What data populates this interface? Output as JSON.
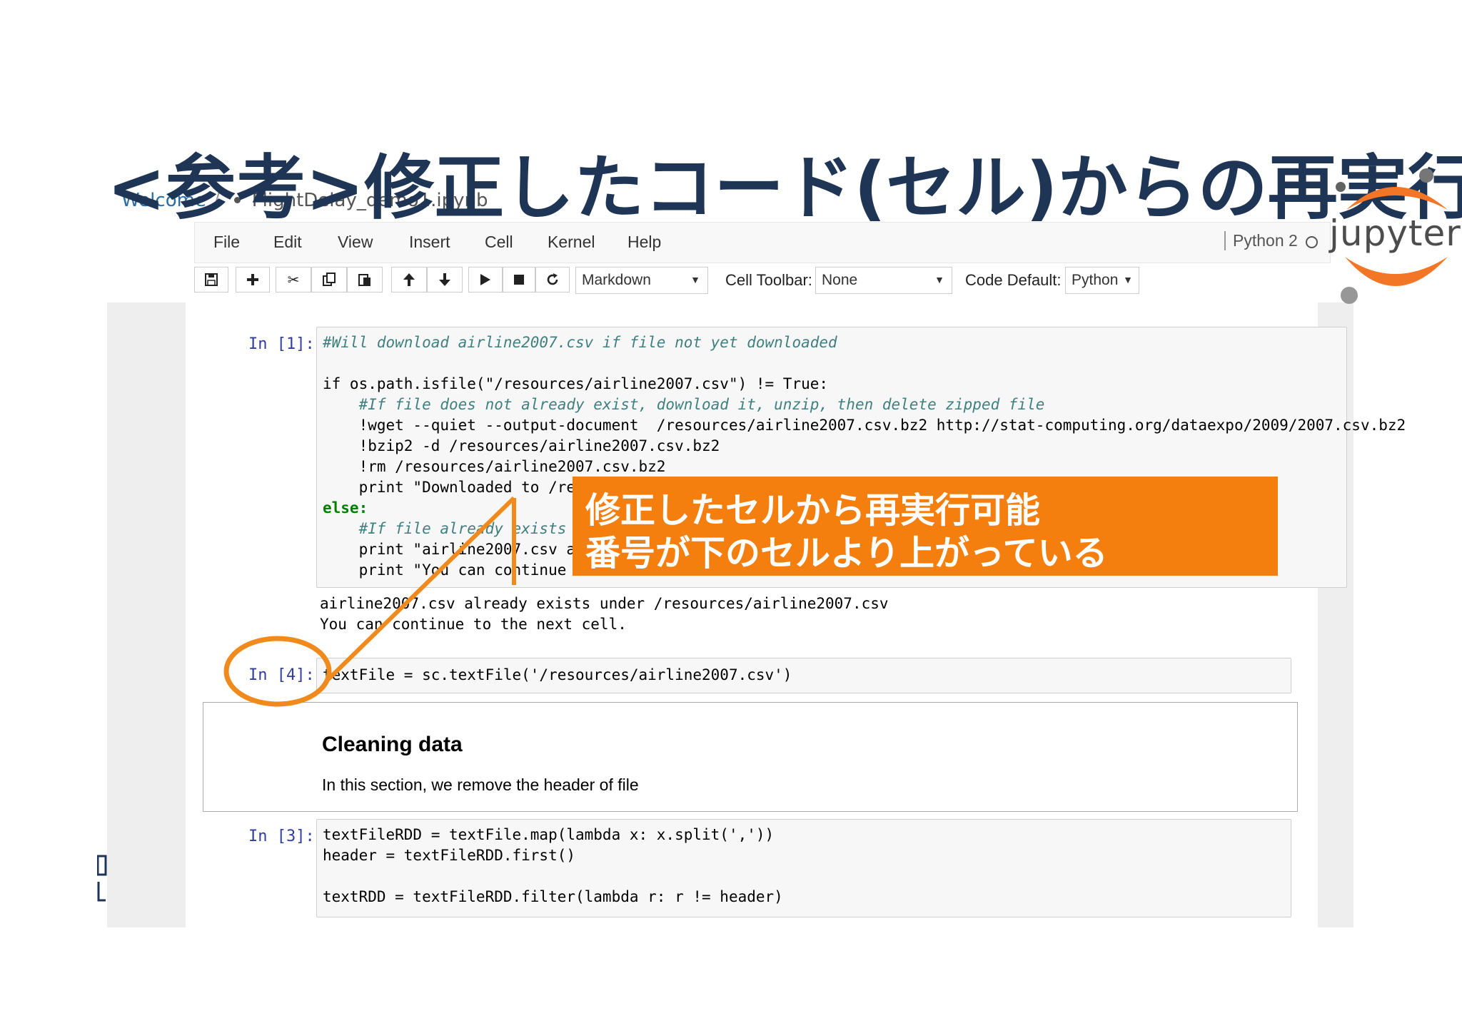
{
  "slide": {
    "title": "<参考>修正したコード(セル)からの再実行"
  },
  "logo": {
    "text": "jupyter",
    "colors": {
      "orange": "#f37626",
      "gray": "#767677"
    }
  },
  "breadcrumb": {
    "root": "Welcome",
    "separator": "/",
    "file": "FlightDelay_demo1.ipynb"
  },
  "menubar": {
    "items": [
      "File",
      "Edit",
      "View",
      "Insert",
      "Cell",
      "Kernel",
      "Help"
    ],
    "kernel_name": "Python 2"
  },
  "toolbar": {
    "buttons": {
      "save": "save-icon",
      "add": "plus-icon",
      "cut": "scissors-icon",
      "copy": "copy-icon",
      "paste": "paste-icon",
      "up": "arrow-up-icon",
      "down": "arrow-down-icon",
      "run": "play-icon",
      "stop": "stop-icon",
      "restart": "restart-icon"
    },
    "cell_type": "Markdown",
    "cell_toolbar_label": "Cell Toolbar:",
    "cell_toolbar_value": "None",
    "code_default_label": "Code Default:",
    "code_default_value": "Python"
  },
  "cells": {
    "c1": {
      "prompt": "In [1]:",
      "lines": [
        "#Will download airline2007.csv if file not yet downloaded",
        "",
        "if os.path.isfile(\"/resources/airline2007.csv\") != True:",
        "    #If file does not already exist, download it, unzip, then delete zipped file",
        "    !wget --quiet --output-document  /resources/airline2007.csv.bz2 http://stat-computing.org/dataexpo/2009/2007.csv.bz2",
        "    !bzip2 -d /resources/airline2007.csv.bz2",
        "    !rm /resources/airline2007.csv.bz2",
        "    print \"Downloaded to /resources",
        "else:",
        "    #If file already exists",
        "    print \"airline2007.csv al",
        "    print \"You can continue to"
      ],
      "output": [
        "airline2007.csv already exists under /resources/airline2007.csv",
        "You can continue to the next cell."
      ]
    },
    "c4": {
      "prompt": "In [4]:",
      "code": "textFile = sc.textFile('/resources/airline2007.csv')"
    },
    "markdown": {
      "heading": "Cleaning data",
      "text": "In this section, we remove the header of file"
    },
    "c3": {
      "prompt": "In [3]:",
      "lines": [
        "textFileRDD = textFile.map(lambda x: x.split(','))",
        "header = textFileRDD.first()",
        "",
        "textRDD = textFileRDD.filter(lambda r: r != header)"
      ]
    }
  },
  "callout": {
    "line1": "修正したセルから再実行可能",
    "line2": "番号が下のセルより上がっている",
    "color": "#f57f0e"
  },
  "accent_colors": {
    "title": "#1e3555",
    "annotation": "#f08a1c",
    "prompt": "#303f9f"
  }
}
